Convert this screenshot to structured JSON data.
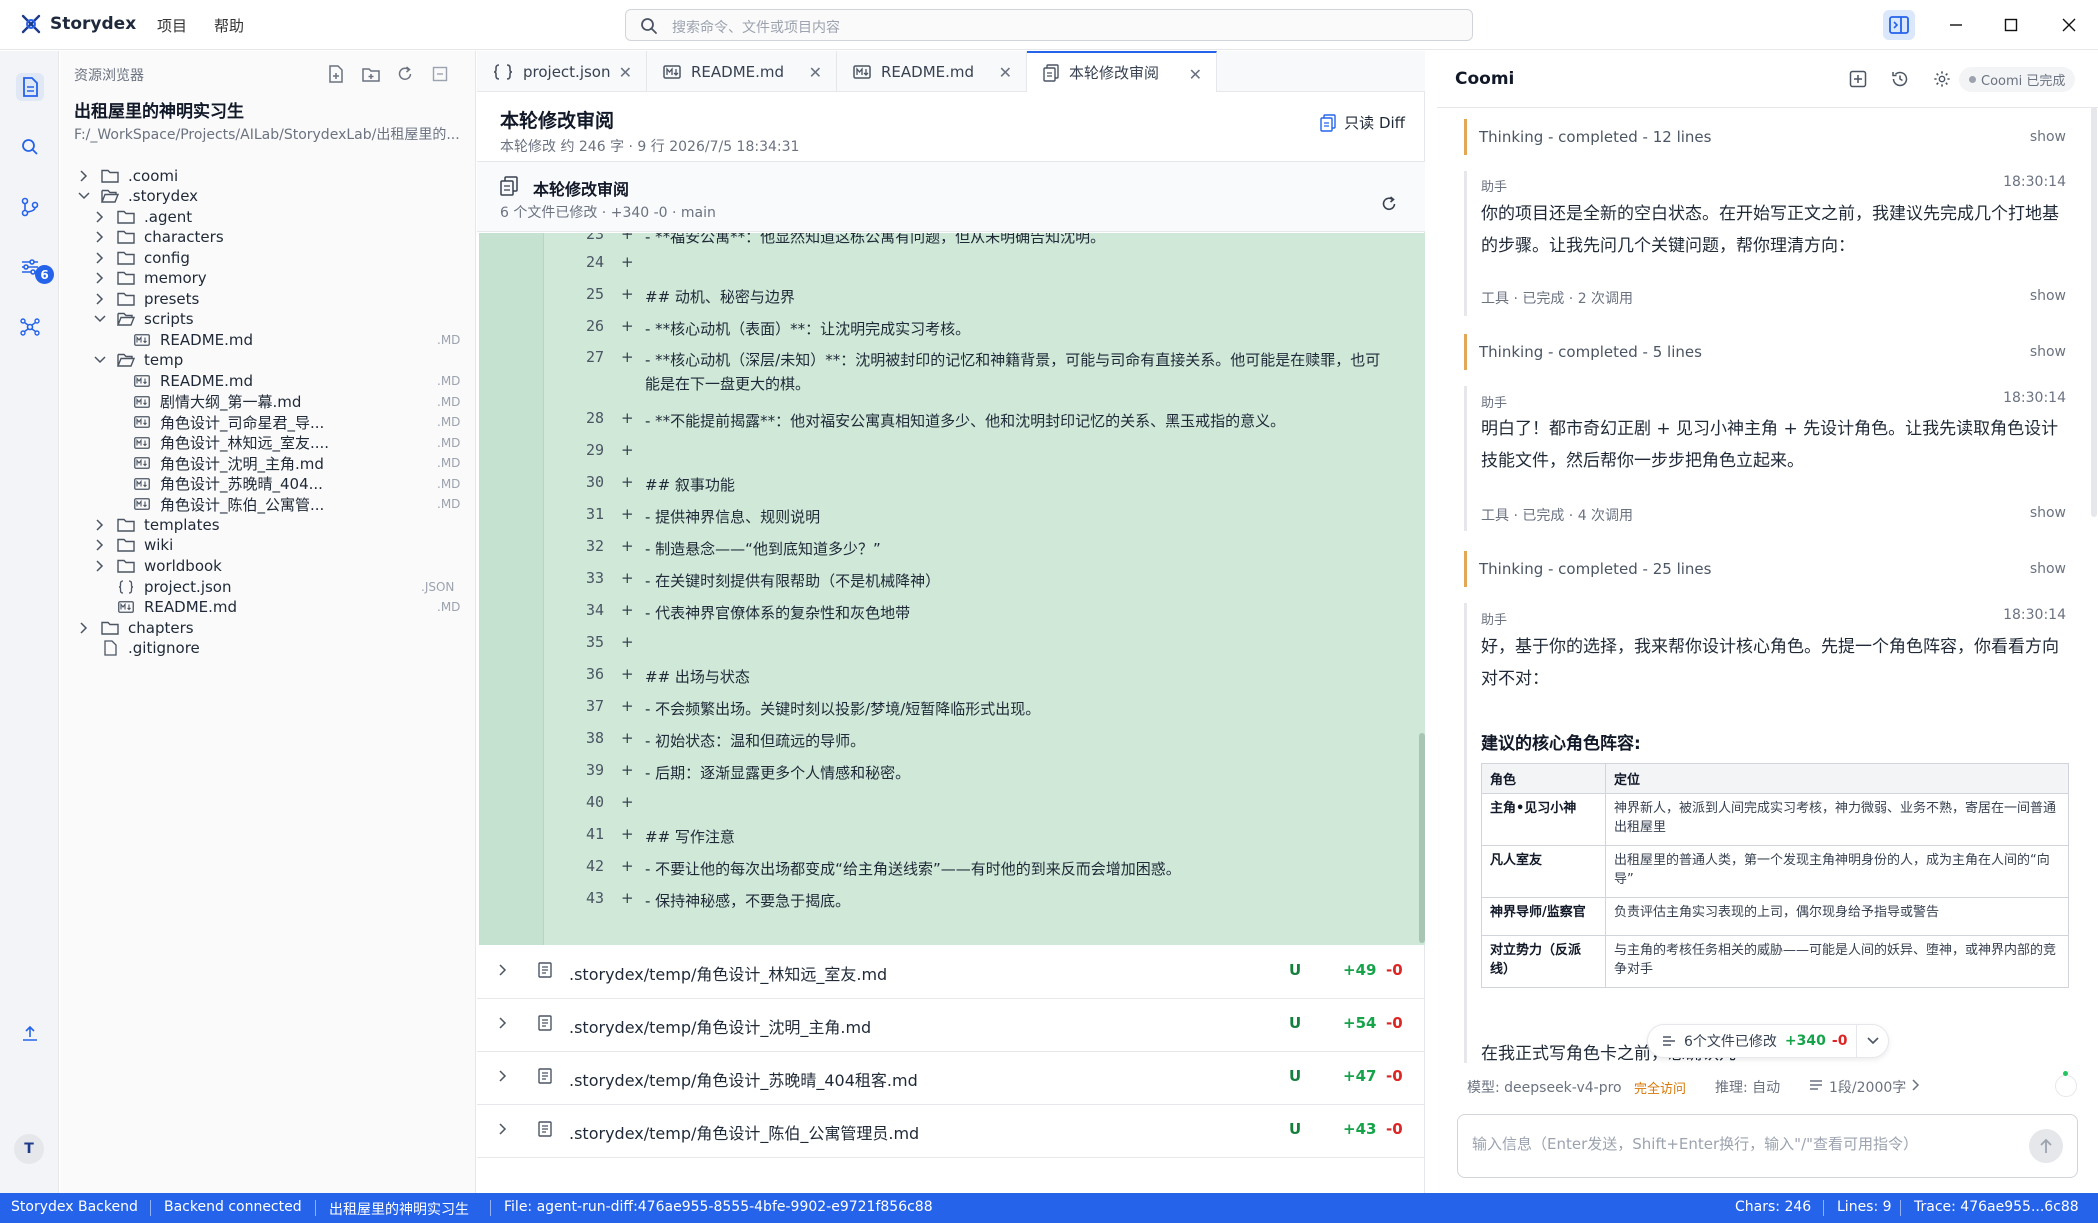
{
  "app": {
    "name": "Storydex",
    "menu": [
      "项目",
      "帮助"
    ],
    "search_placeholder": "搜索命令、文件或项目内容"
  },
  "activity": {
    "git_badge": "6",
    "avatar": "T"
  },
  "explorer": {
    "title": "资源浏览器",
    "project_name": "出租屋里的神明实习生",
    "project_path": "F:/_WorkSpace/Projects/AILab/StorydexLab/出租屋里的...",
    "tree": [
      {
        "label": ".coomi",
        "type": "folder",
        "depth": 0,
        "state": "closed"
      },
      {
        "label": ".storydex",
        "type": "folder",
        "depth": 0,
        "state": "open"
      },
      {
        "label": ".agent",
        "type": "folder",
        "depth": 1,
        "state": "closed"
      },
      {
        "label": "characters",
        "type": "folder",
        "depth": 1,
        "state": "closed"
      },
      {
        "label": "config",
        "type": "folder",
        "depth": 1,
        "state": "closed"
      },
      {
        "label": "memory",
        "type": "folder",
        "depth": 1,
        "state": "closed"
      },
      {
        "label": "presets",
        "type": "folder",
        "depth": 1,
        "state": "closed"
      },
      {
        "label": "scripts",
        "type": "folder",
        "depth": 1,
        "state": "open"
      },
      {
        "label": "README.md",
        "type": "md",
        "depth": 2,
        "ext": "MD"
      },
      {
        "label": "temp",
        "type": "folder",
        "depth": 1,
        "state": "open"
      },
      {
        "label": "README.md",
        "type": "md",
        "depth": 2,
        "ext": "MD"
      },
      {
        "label": "剧情大纲_第一幕.md",
        "type": "md",
        "depth": 2,
        "ext": "MD"
      },
      {
        "label": "角色设计_司命星君_导...",
        "type": "md",
        "depth": 2,
        "ext": "MD"
      },
      {
        "label": "角色设计_林知远_室友....",
        "type": "md",
        "depth": 2,
        "ext": "MD"
      },
      {
        "label": "角色设计_沈明_主角.md",
        "type": "md",
        "depth": 2,
        "ext": "MD"
      },
      {
        "label": "角色设计_苏晚晴_404...",
        "type": "md",
        "depth": 2,
        "ext": "MD"
      },
      {
        "label": "角色设计_陈伯_公寓管...",
        "type": "md",
        "depth": 2,
        "ext": "MD"
      },
      {
        "label": "templates",
        "type": "folder",
        "depth": 1,
        "state": "closed"
      },
      {
        "label": "wiki",
        "type": "folder",
        "depth": 1,
        "state": "closed"
      },
      {
        "label": "worldbook",
        "type": "folder",
        "depth": 1,
        "state": "closed"
      },
      {
        "label": "project.json",
        "type": "json",
        "depth": 1,
        "ext": "JSON"
      },
      {
        "label": "README.md",
        "type": "md",
        "depth": 1,
        "ext": "MD"
      },
      {
        "label": "chapters",
        "type": "folder",
        "depth": 0,
        "state": "closed"
      },
      {
        "label": ".gitignore",
        "type": "file",
        "depth": 0
      }
    ]
  },
  "tabs": [
    {
      "label": "project.json",
      "icon": "braces-icon"
    },
    {
      "label": "README.md",
      "icon": "markdown-icon"
    },
    {
      "label": "README.md",
      "icon": "markdown-icon"
    },
    {
      "label": "本轮修改审阅",
      "icon": "review-icon"
    }
  ],
  "doc": {
    "title": "本轮修改审阅",
    "meta": "本轮修改   约 246 字 · 9 行   2026/7/5 18:34:31",
    "readonly": "只读 Diff"
  },
  "review": {
    "title": "本轮修改审阅",
    "meta": "6 个文件已修改 · +340 -0 · main"
  },
  "diff_lines": [
    {
      "n": "23",
      "t": "- **福安公寓**：他显然知道这栋公寓有问题，但从未明确告知沈明。"
    },
    {
      "n": "24",
      "t": ""
    },
    {
      "n": "25",
      "t": "## 动机、秘密与边界"
    },
    {
      "n": "26",
      "t": "- **核心动机（表面）**：让沈明完成实习考核。"
    },
    {
      "n": "27",
      "t": "- **核心动机（深层/未知）**：沈明被封印的记忆和神籍背景，可能与司命有直接关系。他可能是在赎罪，也可能是在下一盘更大的棋。"
    },
    {
      "n": "28",
      "t": "- **不能提前揭露**：他对福安公寓真相知道多少、他和沈明封印记忆的关系、黑玉戒指的意义。"
    },
    {
      "n": "29",
      "t": ""
    },
    {
      "n": "30",
      "t": "## 叙事功能"
    },
    {
      "n": "31",
      "t": "- 提供神界信息、规则说明"
    },
    {
      "n": "32",
      "t": "- 制造悬念——“他到底知道多少？”"
    },
    {
      "n": "33",
      "t": "- 在关键时刻提供有限帮助（不是机械降神）"
    },
    {
      "n": "34",
      "t": "- 代表神界官僚体系的复杂性和灰色地带"
    },
    {
      "n": "35",
      "t": ""
    },
    {
      "n": "36",
      "t": "## 出场与状态"
    },
    {
      "n": "37",
      "t": "- 不会频繁出场。关键时刻以投影/梦境/短暂降临形式出现。"
    },
    {
      "n": "38",
      "t": "- 初始状态：温和但疏远的导师。"
    },
    {
      "n": "39",
      "t": "- 后期：逐渐显露更多个人情感和秘密。"
    },
    {
      "n": "40",
      "t": ""
    },
    {
      "n": "41",
      "t": "## 写作注意"
    },
    {
      "n": "42",
      "t": "- 不要让他的每次出场都变成“给主角送线索”——有时他的到来反而会增加困惑。"
    },
    {
      "n": "43",
      "t": "- 保持神秘感，不要急于揭底。"
    }
  ],
  "diff_plus": "+",
  "files": [
    {
      "path": ".storydex/temp/角色设计_林知远_室友.md",
      "status": "U",
      "add": "+49",
      "del": "-0"
    },
    {
      "path": ".storydex/temp/角色设计_沈明_主角.md",
      "status": "U",
      "add": "+54",
      "del": "-0"
    },
    {
      "path": ".storydex/temp/角色设计_苏晚晴_404租客.md",
      "status": "U",
      "add": "+47",
      "del": "-0"
    },
    {
      "path": ".storydex/temp/角色设计_陈伯_公寓管理员.md",
      "status": "U",
      "add": "+43",
      "del": "-0"
    }
  ],
  "chat": {
    "title": "Coomi",
    "status": "Coomi 已完成",
    "show": "show",
    "thinking1": "Thinking - completed - 12 lines",
    "role": "助手",
    "time": "18:30:14",
    "msg1": "你的项目还是全新的空白状态。在开始写正文之前，我建议先完成几个打地基的步骤。让我先问几个关键问题，帮你理清方向：",
    "tool1": "工具 · 已完成 · 2 次调用",
    "thinking2": "Thinking - completed - 5 lines",
    "msg2": "明白了！都市奇幻正剧 + 见习小神主角 + 先设计角色。让我先读取角色设计技能文件，然后帮你一步步把角色立起来。",
    "tool2": "工具 · 已完成 · 4 次调用",
    "thinking3": "Thinking - completed - 25 lines",
    "msg3": "好，基于你的选择，我来帮你设计核心角色。先提一个角色阵容，你看看方向对不对：",
    "table_title": "建议的核心角色阵容:",
    "table_headers": [
      "角色",
      "定位"
    ],
    "table_rows": [
      [
        "主角•见习小神",
        "神界新人，被派到人间完成实习考核，神力微弱、业务不熟，寄居在一间普通出租屋里"
      ],
      [
        "凡人室友",
        "出租屋里的普通人类，第一个发现主角神明身份的人，成为主角在人间的“向导”"
      ],
      [
        "神界导师/监察官",
        "负责评估主角实习表现的上司，偶尔现身给予指导或警告"
      ],
      [
        "对立势力（反派线）",
        "与主角的考核任务相关的威胁——可能是人间的妖异、堕神，或神界内部的竞争对手"
      ]
    ],
    "tail_text": "在我正式写角色卡之前，想确认几",
    "floating": {
      "label": "6个文件已修改",
      "add": "+340",
      "del": "-0"
    },
    "model_label": "模型: deepseek-v4-pro",
    "access": "完全访问",
    "reason": "推理: 自动",
    "counter": "1段/2000字",
    "input_placeholder": "输入信息（Enter发送，Shift+Enter换行，输入\"/\"查看可用指令）"
  },
  "statusbar": {
    "backend": "Storydex Backend",
    "connected": "Backend connected",
    "project": "出租屋里的神明实习生",
    "file": "File: agent-run-diff:476ae955-8555-4bfe-9902-e9721f856c88",
    "chars": "Chars: 246",
    "lines": "Lines: 9",
    "trace": "Trace: 476ae955...6c88"
  },
  "colors": {
    "accent": "#2563eb",
    "diff_bg": "#cfe8d8",
    "add": "#16a34a",
    "del": "#dc2626",
    "thinking_bar": "#e3a857"
  }
}
